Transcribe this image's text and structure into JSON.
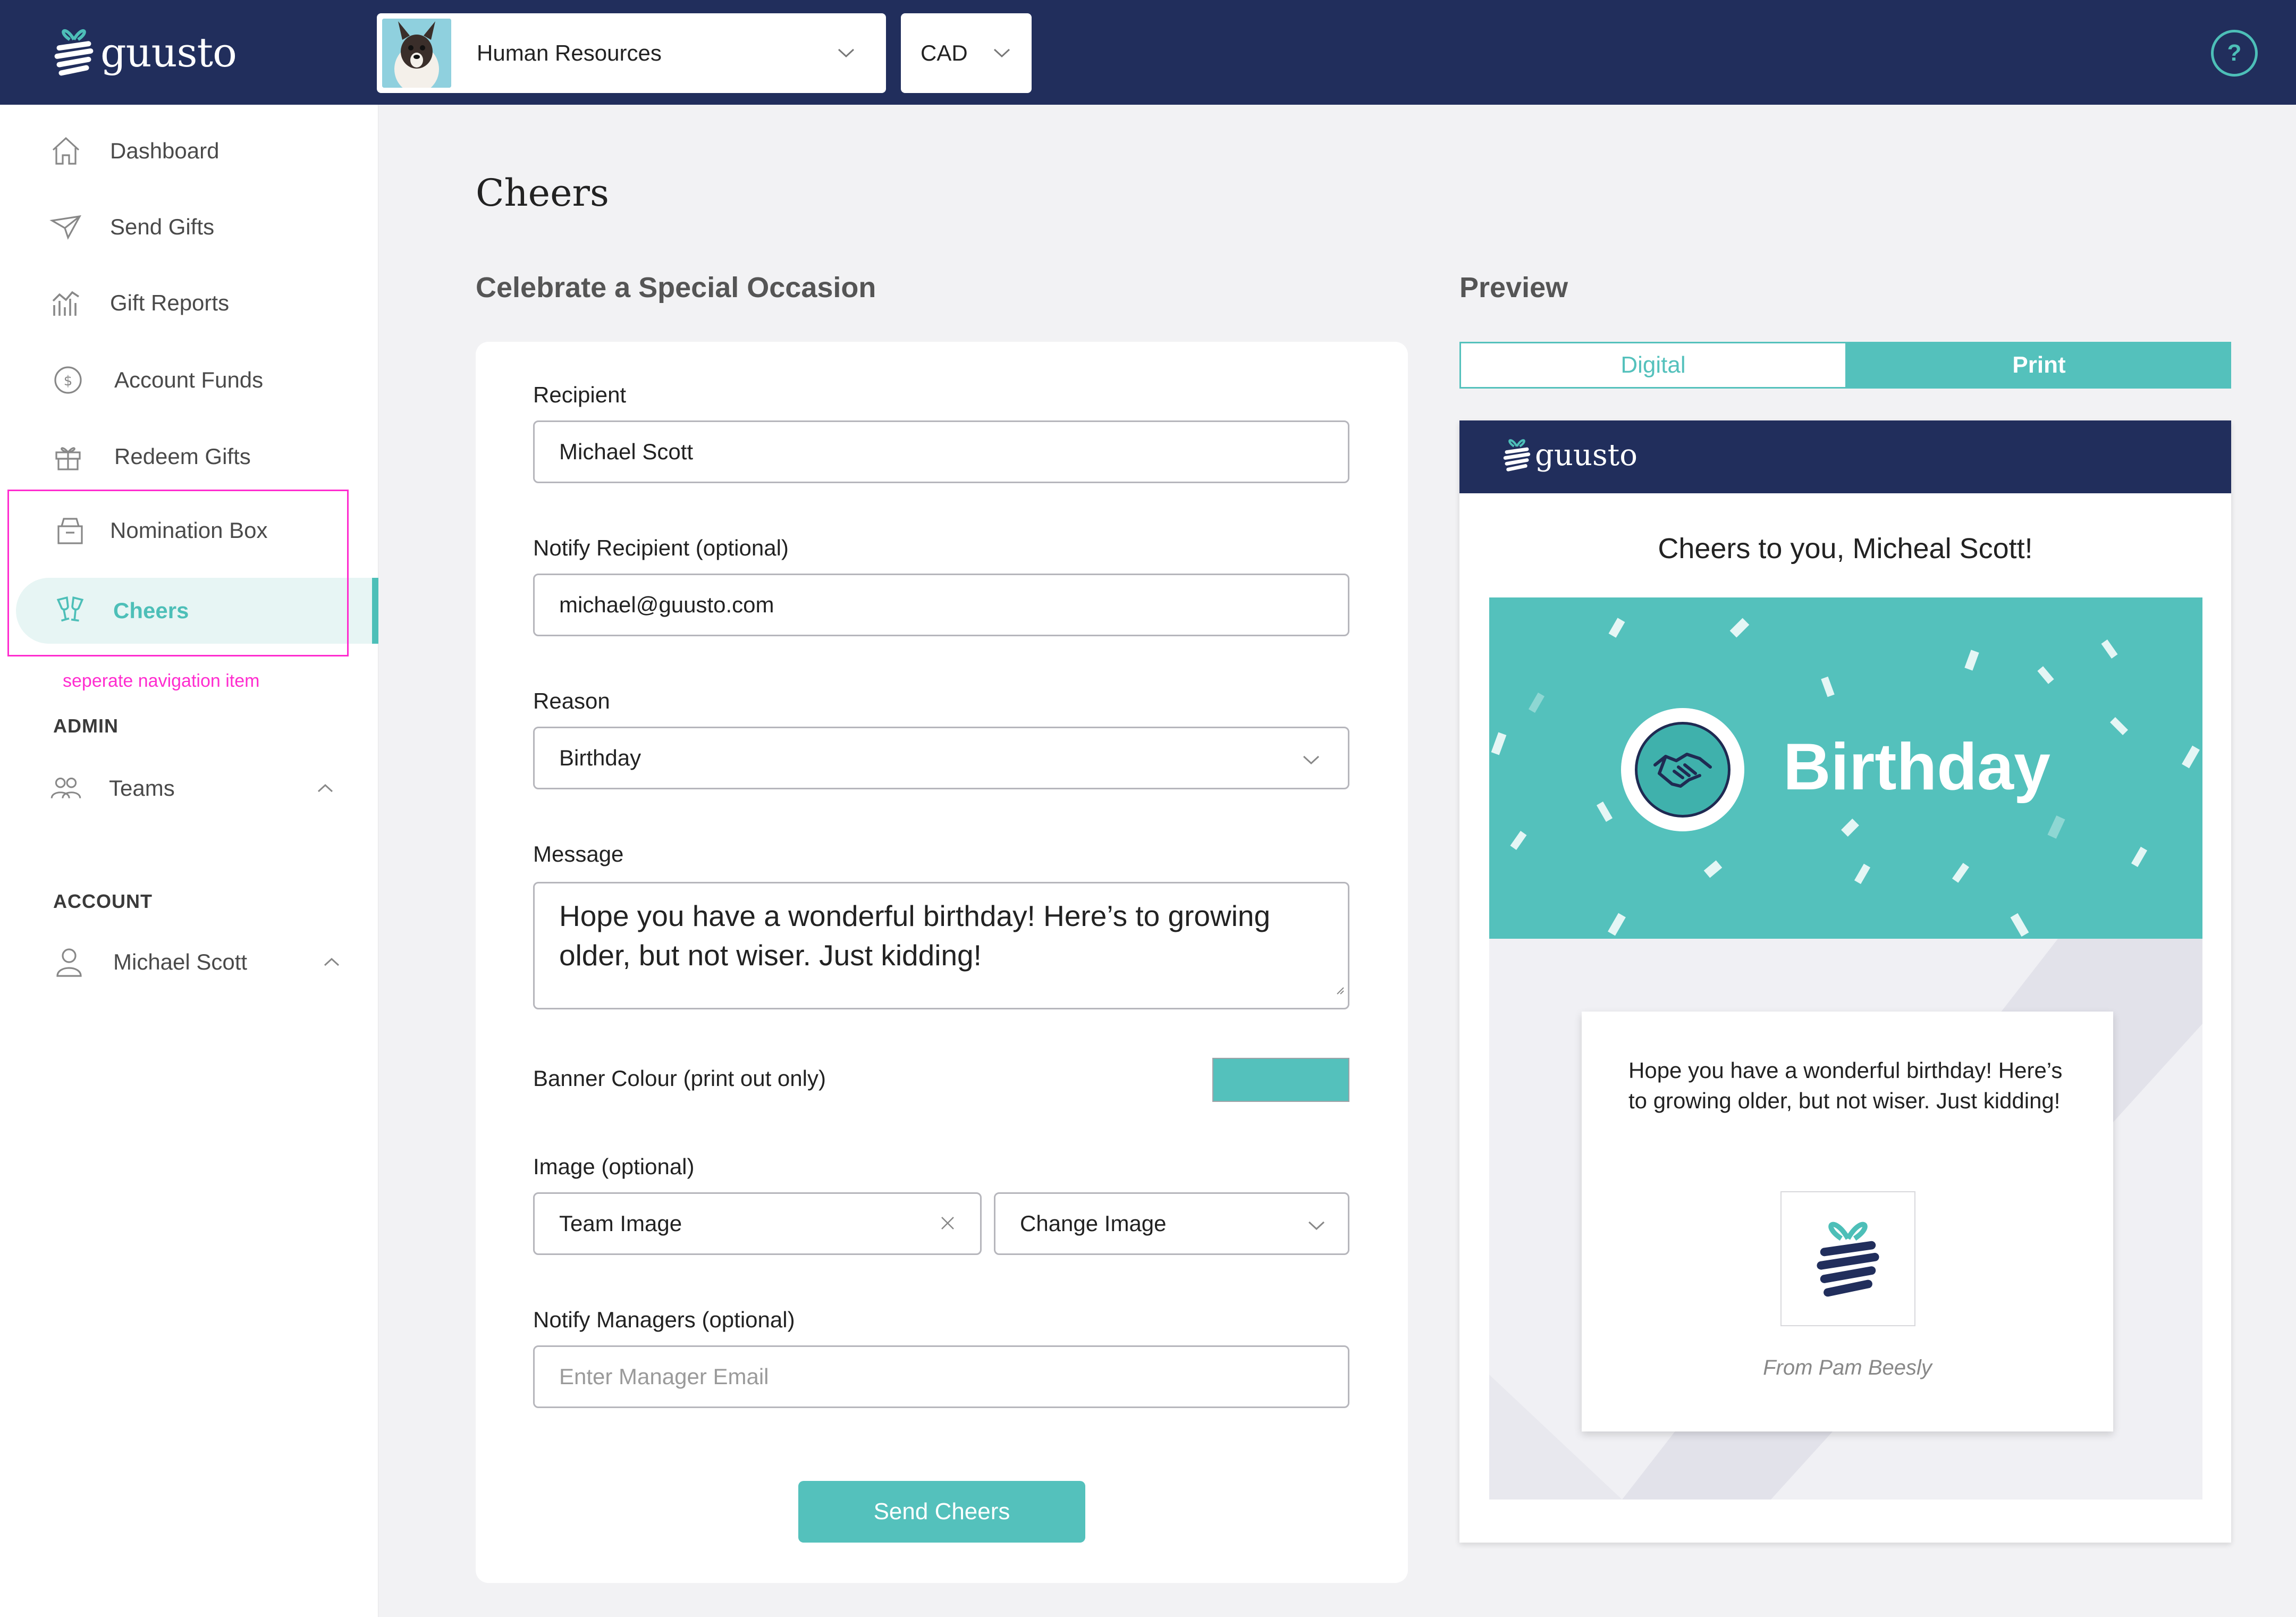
{
  "app": {
    "brand": "guusto",
    "org_selector": {
      "value": "Human Resources"
    },
    "currency_selector": {
      "value": "CAD"
    },
    "help_label": "?"
  },
  "sidebar": {
    "items": [
      {
        "label": "Dashboard",
        "icon": "home-icon"
      },
      {
        "label": "Send Gifts",
        "icon": "paper-plane-icon"
      },
      {
        "label": "Gift Reports",
        "icon": "chart-icon"
      },
      {
        "label": "Account Funds",
        "icon": "dollar-circle-icon"
      },
      {
        "label": "Redeem Gifts",
        "icon": "gift-icon"
      },
      {
        "label": "Nomination Box",
        "icon": "box-icon"
      },
      {
        "label": "Cheers",
        "icon": "champagne-glasses-icon",
        "active": true
      }
    ],
    "annotation": "seperate navigation item",
    "admin_label": "ADMIN",
    "admin_items": [
      {
        "label": "Teams",
        "icon": "people-icon"
      }
    ],
    "account_label": "ACCOUNT",
    "account_items": [
      {
        "label": "Michael Scott",
        "icon": "user-icon"
      }
    ]
  },
  "page": {
    "title": "Cheers",
    "form_title": "Celebrate a Special Occasion",
    "preview_title": "Preview"
  },
  "form": {
    "recipient": {
      "label": "Recipient",
      "value": "Michael Scott"
    },
    "notify": {
      "label": "Notify Recipient (optional)",
      "value": "michael@guusto.com"
    },
    "reason": {
      "label": "Reason",
      "value": "Birthday"
    },
    "message": {
      "label": "Message",
      "value": "Hope you have a wonderful birthday! Here’s to growing older, but not wiser. Just kidding!"
    },
    "banner_colour": {
      "label": "Banner Colour (print out only)",
      "value": "#54c1bc"
    },
    "image": {
      "label": "Image (optional)",
      "value": "Team Image",
      "change_label": "Change Image"
    },
    "managers": {
      "label": "Notify Managers (optional)",
      "placeholder": "Enter Manager Email"
    },
    "submit_label": "Send Cheers"
  },
  "preview": {
    "tabs": [
      {
        "label": "Digital",
        "active": false
      },
      {
        "label": "Print",
        "active": true
      }
    ],
    "brand": "guusto",
    "greeting": "Cheers to you, Micheal Scott!",
    "banner_title": "Birthday",
    "note_message": "Hope you have a wonderful birthday! Here’s to growing older, but not wiser. Just kidding!",
    "note_from": "From Pam Beesly"
  },
  "colors": {
    "navy": "#212e5c",
    "accent": "#54c1bc",
    "annotation": "#ff2ccf"
  }
}
